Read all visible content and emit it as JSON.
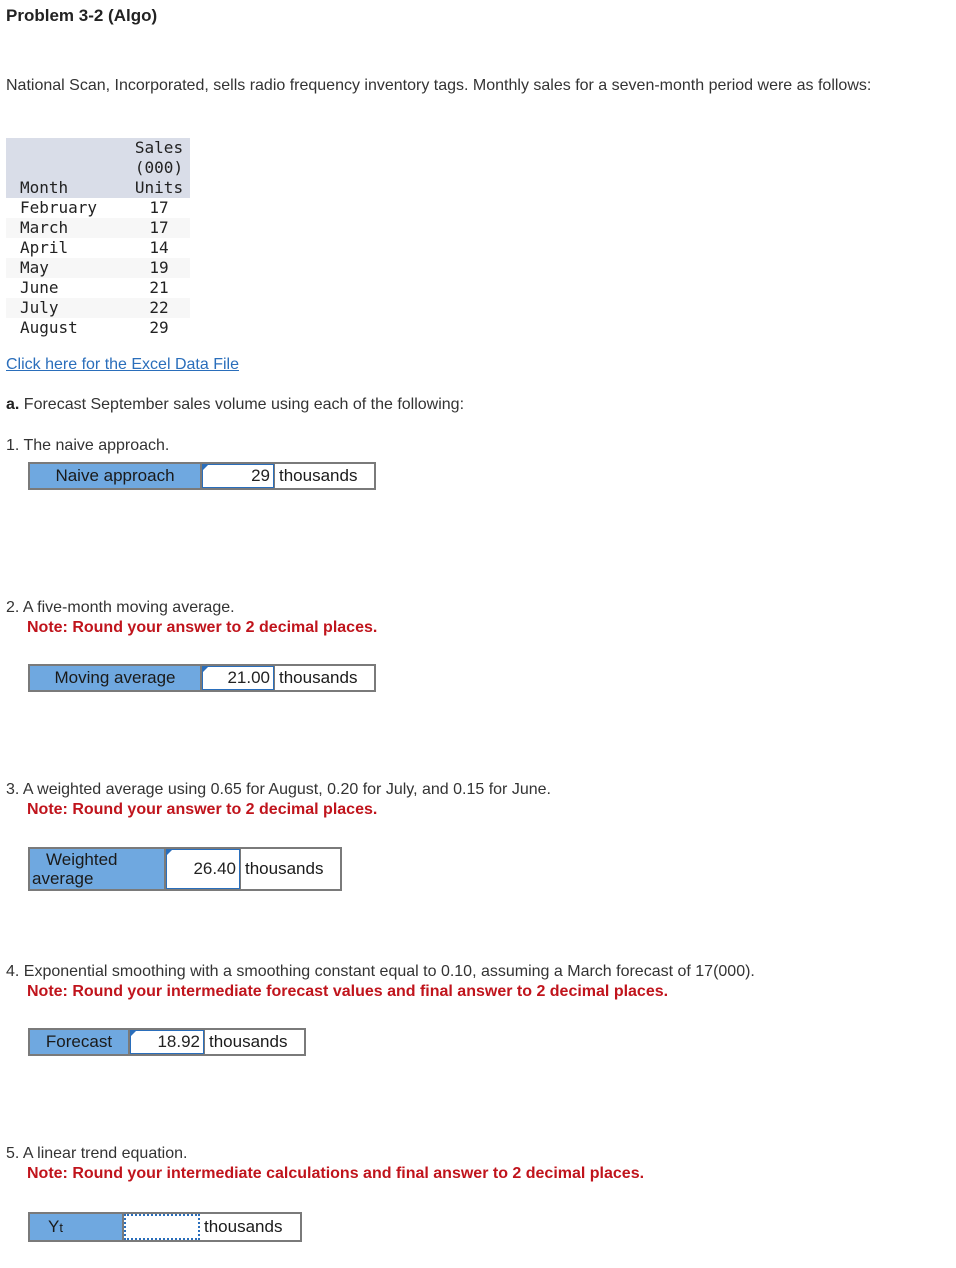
{
  "title": "Problem 3-2 (Algo)",
  "intro": "National Scan, Incorporated, sells radio frequency inventory tags. Monthly sales for a seven-month period were as follows:",
  "table": {
    "header_month": "Month",
    "header_sales_1": "Sales",
    "header_sales_2": "(000)",
    "header_sales_3": "Units",
    "rows": [
      {
        "month": "February",
        "units": "17"
      },
      {
        "month": "March",
        "units": "17"
      },
      {
        "month": "April",
        "units": "14"
      },
      {
        "month": "May",
        "units": "19"
      },
      {
        "month": "June",
        "units": "21"
      },
      {
        "month": "July",
        "units": "22"
      },
      {
        "month": "August",
        "units": "29"
      }
    ]
  },
  "excel_link": "Click here for the Excel Data File",
  "part_a": {
    "prefix": "a.",
    "text": " Forecast September sales volume using each of the following:"
  },
  "questions": [
    {
      "text": "1. The naive approach.",
      "note": "",
      "label": "Naive approach",
      "value": "29",
      "unit": "thousands"
    },
    {
      "text": "2. A five-month moving average.",
      "note": "Note: Round your answer to 2 decimal places.",
      "label": "Moving average",
      "value": "21.00",
      "unit": "thousands"
    },
    {
      "text": "3. A weighted average using 0.65 for August, 0.20 for July, and 0.15 for June.",
      "note": "Note: Round your answer to 2 decimal places.",
      "label_1": "Weighted",
      "label_2": "average",
      "value": "26.40",
      "unit": "thousands"
    },
    {
      "text": "4. Exponential smoothing with a smoothing constant equal to 0.10, assuming a March forecast of 17(000).",
      "note": "Note: Round your intermediate forecast values and final answer to 2 decimal places.",
      "label": "Forecast",
      "value": "18.92",
      "unit": "thousands"
    },
    {
      "text": "5. A linear trend equation.",
      "note": "Note: Round your intermediate calculations and final answer to 2 decimal places.",
      "label_main": "Y",
      "label_sub": "t",
      "value": "",
      "unit": "thousands"
    }
  ]
}
